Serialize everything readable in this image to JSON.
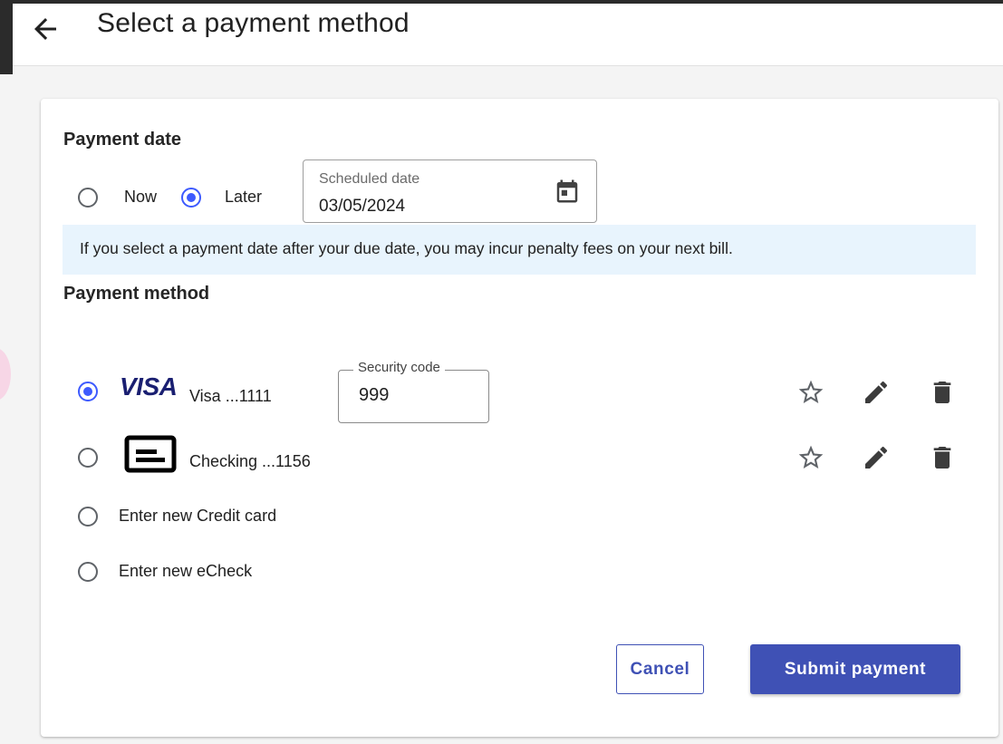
{
  "header": {
    "title": "Select a payment method",
    "back_icon": "arrow-left-icon"
  },
  "payment_date": {
    "title": "Payment date",
    "options": [
      {
        "label": "Now",
        "selected": false
      },
      {
        "label": "Later",
        "selected": true
      }
    ],
    "scheduled_date": {
      "label": "Scheduled date",
      "value": "03/05/2024",
      "icon": "calendar-icon"
    },
    "info_text": "If you select a payment date after your due date, you may incur penalty fees on your next bill."
  },
  "payment_method": {
    "title": "Payment method",
    "methods": [
      {
        "brand": "VISA",
        "label": "Visa ...1111",
        "selected": true,
        "security_code_label": "Security code",
        "security_code_value": "999"
      },
      {
        "brand_icon": "bank-check-icon",
        "label": "Checking ...1156",
        "selected": false
      }
    ],
    "new_options": [
      {
        "label": "Enter new Credit card",
        "selected": false
      },
      {
        "label": "Enter new eCheck",
        "selected": false
      }
    ],
    "row_icons": [
      "star-outline-icon",
      "pencil-icon",
      "trash-icon"
    ]
  },
  "actions": {
    "cancel_label": "Cancel",
    "submit_label": "Submit payment"
  },
  "colors": {
    "accent": "#3f51b5",
    "radio_selected": "#3d5afe",
    "info_banner": "#e8f4fd",
    "visa_blue": "#1a1f71"
  }
}
